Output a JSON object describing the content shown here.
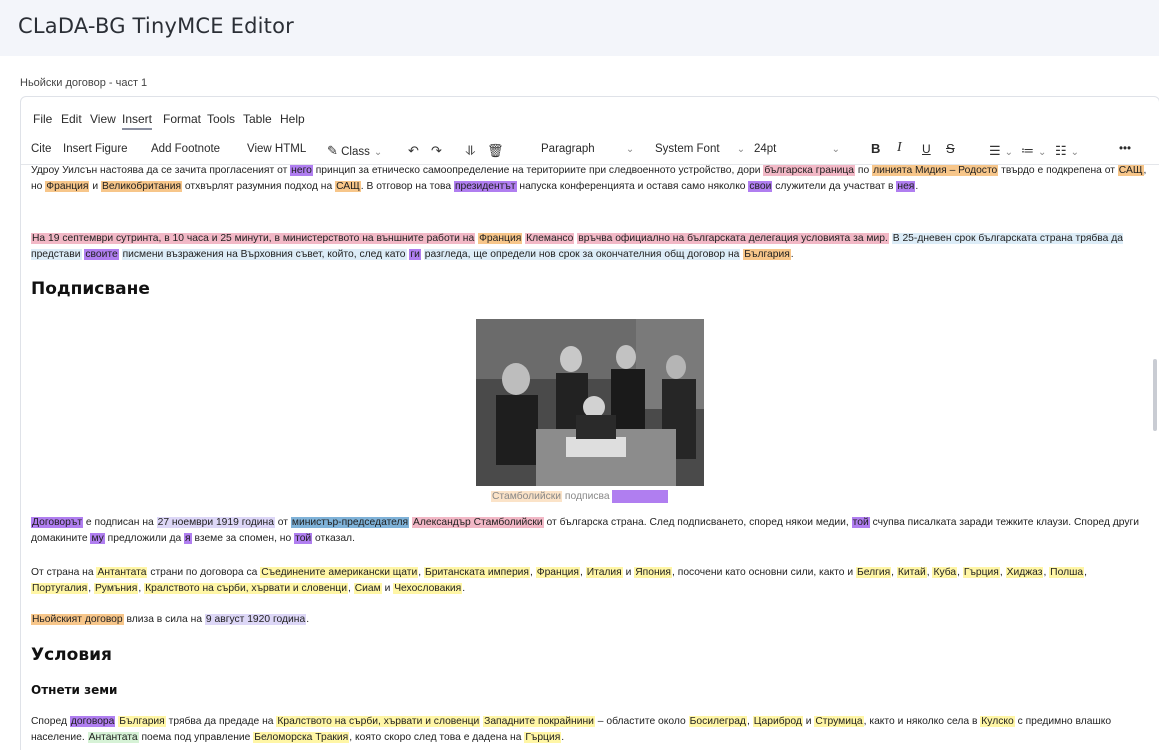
{
  "app": {
    "title": "CLaDA-BG TinyMCE Editor"
  },
  "document": {
    "title": "Ньойски договор - част 1"
  },
  "menubar": [
    "File",
    "Edit",
    "View",
    "Insert",
    "Format",
    "Tools",
    "Table",
    "Help"
  ],
  "menubar_active": "Insert",
  "toolbar": {
    "cite": "Cite",
    "insert_figure": "Insert Figure",
    "add_footnote": "Add Footnote",
    "view_html": "View HTML",
    "class_label": "Class",
    "block_format": "Paragraph",
    "font_family": "System Font",
    "font_size": "24pt",
    "bold": "B",
    "italic": "I",
    "underline": "U",
    "strike": "S",
    "more": "•••"
  },
  "content": {
    "heading_signing": "Подписване",
    "heading_terms": "Условия",
    "heading_lands": "Отнети земи",
    "caption": {
      "name": "Стамболийски",
      "rest": "подписва"
    }
  },
  "colors": {
    "pink": "#f2b8c6",
    "purple": "#b07ef0",
    "yellow": "#fff6a6",
    "orange": "#f7c68a",
    "blue": "#7fb2d8"
  }
}
